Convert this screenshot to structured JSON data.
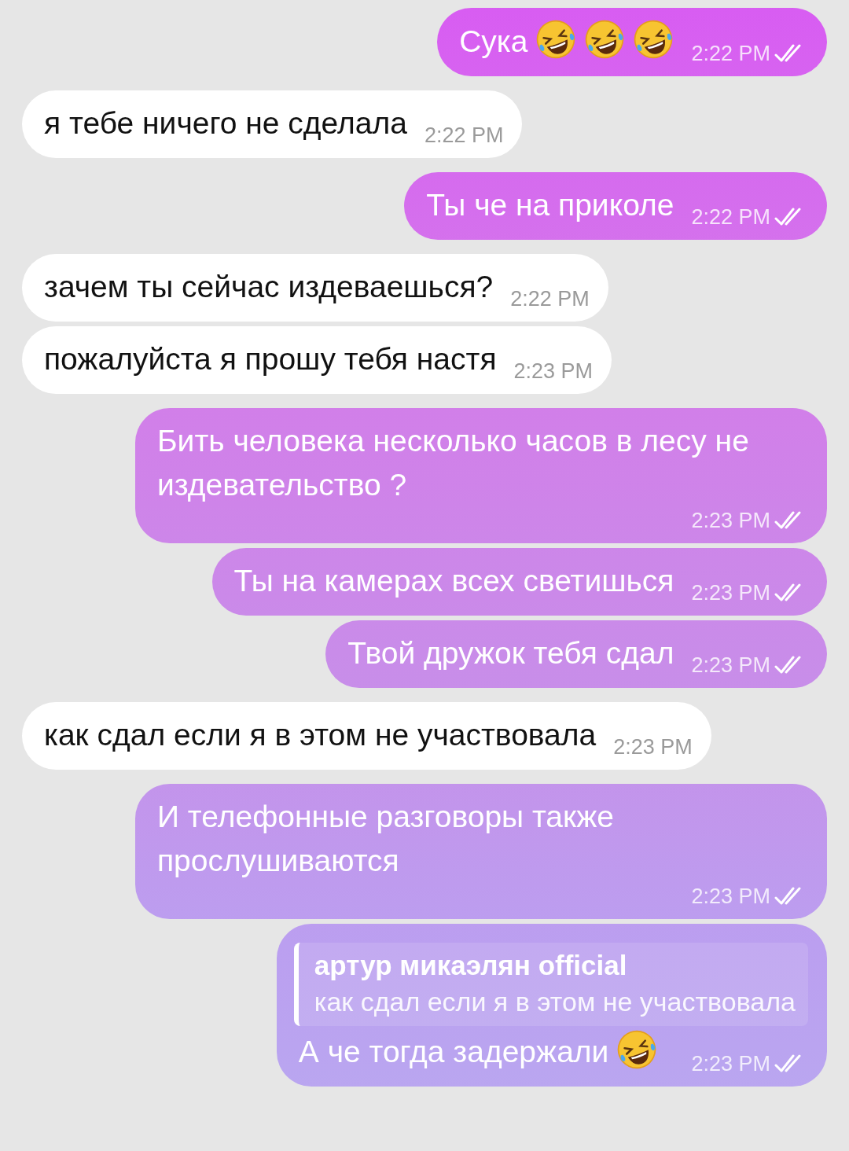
{
  "messages": [
    {
      "kind": "outgoing",
      "text": "Сука",
      "emojis": [
        {
          "kind": "laugh"
        },
        {
          "kind": "laugh"
        },
        {
          "kind": "laugh"
        }
      ],
      "time": "2:22 PM",
      "read": true
    },
    {
      "kind": "incoming",
      "text": "я тебе ничего не сделала",
      "time": "2:22 PM"
    },
    {
      "kind": "outgoing",
      "text": "Ты че на приколе",
      "time": "2:22 PM",
      "read": true
    },
    {
      "kind": "incoming",
      "text": "зачем ты сейчас издеваешься?",
      "time": "2:22 PM"
    },
    {
      "kind": "incoming",
      "text": "пожалуйста я прошу тебя настя",
      "time": "2:23 PM"
    },
    {
      "kind": "outgoing",
      "text": "Бить человека несколько часов в лесу не издевательство ?",
      "time": "2:23 PM",
      "read": true
    },
    {
      "kind": "outgoing",
      "text": "Ты на камерах всех светишься",
      "time": "2:23 PM",
      "read": true
    },
    {
      "kind": "outgoing",
      "text": "Твой дружок тебя сдал",
      "time": "2:23 PM",
      "read": true
    },
    {
      "kind": "incoming",
      "text": "как сдал если я в этом не участвовала",
      "time": "2:23 PM"
    },
    {
      "kind": "outgoing",
      "text": "И телефонные разговоры также прослушиваются",
      "time": "2:23 PM",
      "read": true
    },
    {
      "kind": "outgoing",
      "reply": {
        "author": "артур микаэлян official",
        "text": "как сдал если я в этом не участвовала"
      },
      "text": "А че тогда задержали",
      "emojis": [
        {
          "kind": "laugh"
        }
      ],
      "time": "2:23 PM",
      "read": true
    }
  ]
}
